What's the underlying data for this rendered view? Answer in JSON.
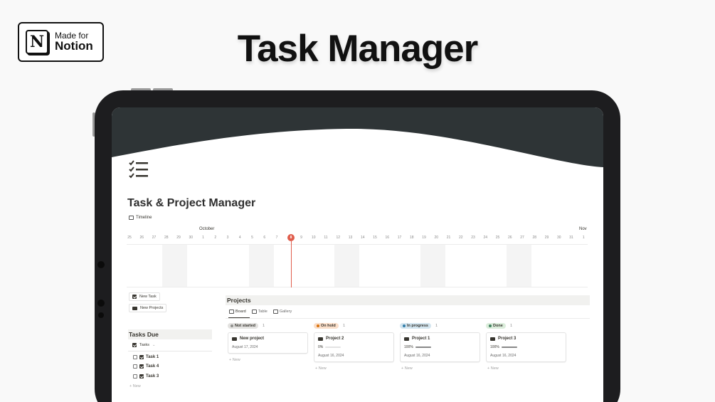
{
  "badge": {
    "top": "Made for",
    "bottom": "Notion",
    "logo_letter": "N"
  },
  "hero_title": "Task Manager",
  "page": {
    "icon": "checklist-icon",
    "title": "Task & Project Manager",
    "view_tab": "Timeline"
  },
  "timeline": {
    "months": {
      "october": "October",
      "nov": "Nov"
    },
    "days": [
      "25",
      "26",
      "27",
      "28",
      "29",
      "30",
      "1",
      "2",
      "3",
      "4",
      "5",
      "6",
      "7",
      "8",
      "9",
      "10",
      "11",
      "12",
      "13",
      "14",
      "15",
      "16",
      "17",
      "18",
      "19",
      "20",
      "21",
      "22",
      "23",
      "24",
      "25",
      "26",
      "27",
      "28",
      "29",
      "30",
      "31",
      "1"
    ],
    "today": "8"
  },
  "buttons": {
    "new_task": "New Task",
    "new_projects": "New Projects"
  },
  "tasks_due": {
    "title": "Tasks Due",
    "view": "Tasks",
    "items": [
      "Task 1",
      "Task 4",
      "Task 3"
    ],
    "new": "+ New"
  },
  "projects": {
    "title": "Projects",
    "tabs": [
      "Board",
      "Table",
      "Gallery"
    ],
    "columns": [
      {
        "label": "Not started",
        "count": "1",
        "card_title": "New project",
        "progress": "",
        "date": "August 17, 2024",
        "new": "+ New",
        "color": "#e3e2e0",
        "dot": "#91918e"
      },
      {
        "label": "On hold",
        "count": "1",
        "card_title": "Project 2",
        "progress": "0%",
        "date": "August 16, 2024",
        "new": "+ New",
        "color": "#fadec9",
        "dot": "#d9730d"
      },
      {
        "label": "In progress",
        "count": "1",
        "card_title": "Project 1",
        "progress": "100%",
        "date": "August 16, 2024",
        "new": "+ New",
        "color": "#d3e5ef",
        "dot": "#337ea9"
      },
      {
        "label": "Done",
        "count": "1",
        "card_title": "Project 3",
        "progress": "100%",
        "date": "August 16, 2024",
        "new": "+ New",
        "color": "#dbeddb",
        "dot": "#448361"
      }
    ]
  },
  "colors": {
    "cover": "#2e3436",
    "today": "#e05c4b",
    "section_bg": "#f1f1ef"
  }
}
